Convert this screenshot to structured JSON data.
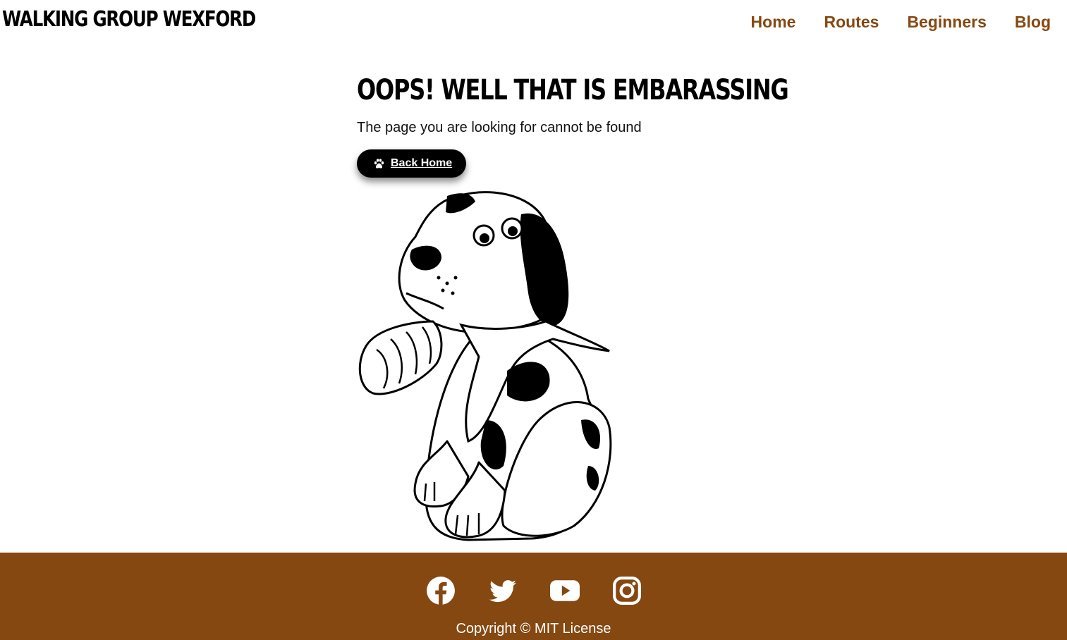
{
  "navbar": {
    "brand": "WALKING GROUP WEXFORD",
    "links": [
      "Home",
      "Routes",
      "Beginners",
      "Blog"
    ]
  },
  "main": {
    "headline": "OOPS! WELL THAT IS EMBARASSING",
    "subtext": "The page you are looking for cannot be found",
    "back_button": {
      "label": "Back Home",
      "icon": "paw-icon"
    },
    "illustration": "sad-injured-dog-illustration"
  },
  "footer": {
    "social": [
      "facebook-icon",
      "twitter-icon",
      "youtube-icon",
      "instagram-icon"
    ],
    "copyright": "Copyright © MIT License"
  },
  "colors": {
    "accent_brown": "#854811",
    "text": "#111111",
    "button_bg": "#000000",
    "footer_text": "#ffffff"
  }
}
